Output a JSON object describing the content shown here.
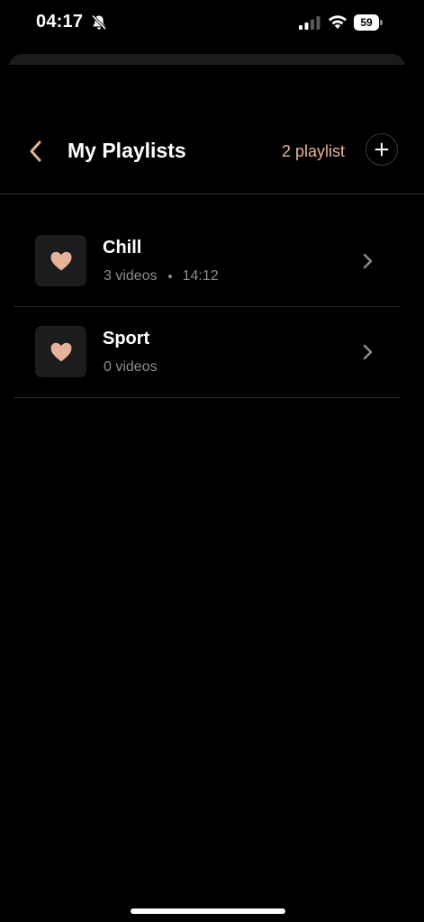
{
  "status_bar": {
    "time": "04:17",
    "battery": "59",
    "icons": [
      "bell-slash-icon",
      "signal-icon",
      "wifi-icon",
      "battery-icon"
    ]
  },
  "header": {
    "title": "My Playlists",
    "count_label": "2 playlist",
    "back_icon": "chevron-left-icon",
    "add_icon": "plus-icon"
  },
  "playlists": [
    {
      "title": "Chill",
      "videos": "3 videos",
      "duration": "14:12",
      "icon": "heart-icon"
    },
    {
      "title": "Sport",
      "videos": "0 videos",
      "duration": "",
      "icon": "heart-icon"
    }
  ],
  "colors": {
    "accent": "#e6b29a",
    "background": "#000000",
    "muted_text": "#8d8d8d"
  }
}
